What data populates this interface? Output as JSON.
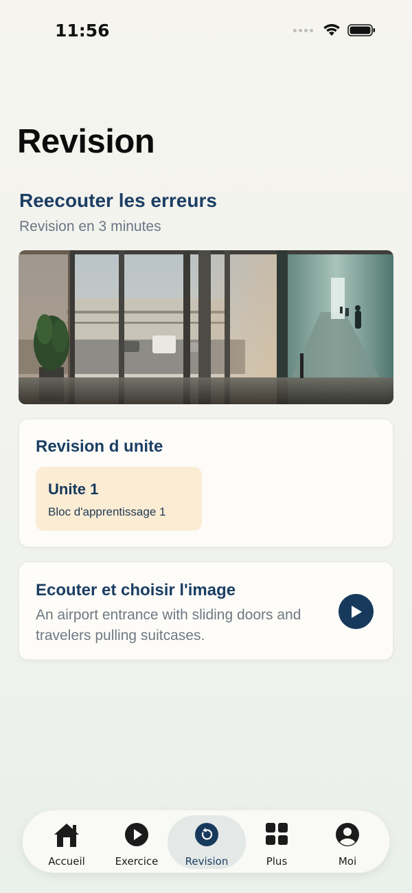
{
  "status_bar": {
    "time": "11:56"
  },
  "page": {
    "title": "Revision"
  },
  "mistakes_section": {
    "title": "Reecouter les erreurs",
    "subtitle": "Revision en 3 minutes"
  },
  "unit_review": {
    "title": "Revision d unite",
    "units": [
      {
        "title": "Unite 1",
        "subtitle": "Bloc d'apprentissage 1",
        "color": "#fbecd4"
      }
    ]
  },
  "listen_exercise": {
    "title": "Ecouter et choisir l'image",
    "description": "An airport entrance with sliding doors and travelers pulling suitcases.",
    "button_icon": "play-icon"
  },
  "bottom_nav": {
    "items": [
      {
        "label": "Accueil",
        "icon": "home-icon",
        "active": false
      },
      {
        "label": "Exercice",
        "icon": "play-circle-icon",
        "active": false
      },
      {
        "label": "Revision",
        "icon": "refresh-circle-icon",
        "active": true
      },
      {
        "label": "Plus",
        "icon": "grid-icon",
        "active": false
      },
      {
        "label": "Moi",
        "icon": "profile-icon",
        "active": false
      }
    ]
  },
  "colors": {
    "accent": "#173a5c",
    "unit_chip": "#fbecd4",
    "background": "#f3f3ef"
  }
}
